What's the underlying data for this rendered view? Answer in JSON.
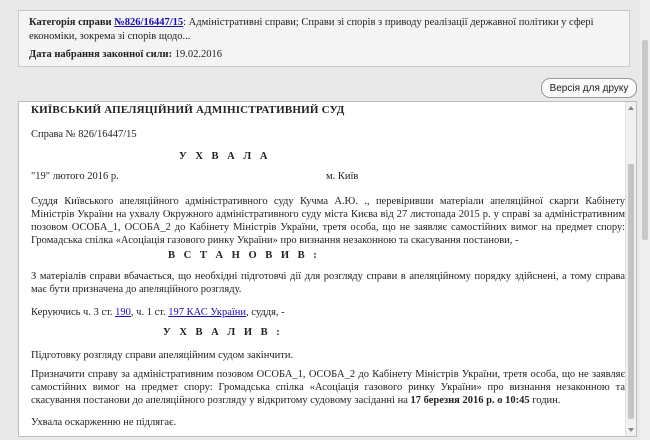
{
  "header": {
    "category_label": "Категорія справи",
    "category_link": "№826/16447/15",
    "category_text": ": Адміністративні справи; Справи зі спорів з приводу реалізації державної політики у сфері економіки, зокрема зі спорів щодо...",
    "effective_label": "Дата набрання законної сили:",
    "effective_value": "19.02.2016"
  },
  "print_button": "Версія для друку",
  "document": {
    "court": "КИЇВСЬКИЙ АПЕЛЯЦІЙНИЙ АДМІНІСТРАТИВНИЙ СУД",
    "case_no": "Справа № 826/16447/15",
    "title_ruling": "У Х В А Л А",
    "date": "\"19\" лютого 2016 р.",
    "city": "м. Київ",
    "para1": "Суддя Київського апеляційного адміністративного суду  Кучма А.Ю. ., перевіривши матеріали апеляційної скарги Кабінету Міністрів України на ухвалу Окружного адміністративного суду міста Києва від 27 листопада 2015 р. у справі за адміністративним позовом ОСОБА_1, ОСОБА_2 до Кабінету Міністрів України, третя особа, що не заявляє самостійних вимог на предмет спору: Громадська спілка «Асоціація газового ринку України» про визнання незаконною та скасування постанови, -",
    "title_established": "В С Т А Н О В И В :",
    "para2": "З матеріалів справи вбачається, що необхідні підготовчі дії для розгляду справи в апеляційному порядку здійснені, а тому справа має бути призначена до апеляційного розгляду.",
    "guided_prefix": "Керуючись ч. 3 ст. ",
    "guided_link1": "190",
    "guided_mid": ", ч. 1 ст. ",
    "guided_link2": "197 КАС України",
    "guided_suffix": ", суддя, -",
    "title_decided": "У Х В А Л И В :",
    "para3": "Підготовку розгляду справи апеляційним судом закінчити.",
    "para4_text": "Призначити справу за адміністративним позовом ОСОБА_1, ОСОБА_2 до Кабінету Міністрів України, третя особа, що не заявляє самостійних вимог на предмет спору: Громадська спілка «Асоціація газового ринку України» про визнання незаконною та скасування постанови до апеляційного розгляду у відкритому судовому засіданні на ",
    "para4_bold": "17 березня 2016 р. о  10:45",
    "para4_end": " годин.",
    "para5": "Ухвала оскарженню не підлягає."
  }
}
